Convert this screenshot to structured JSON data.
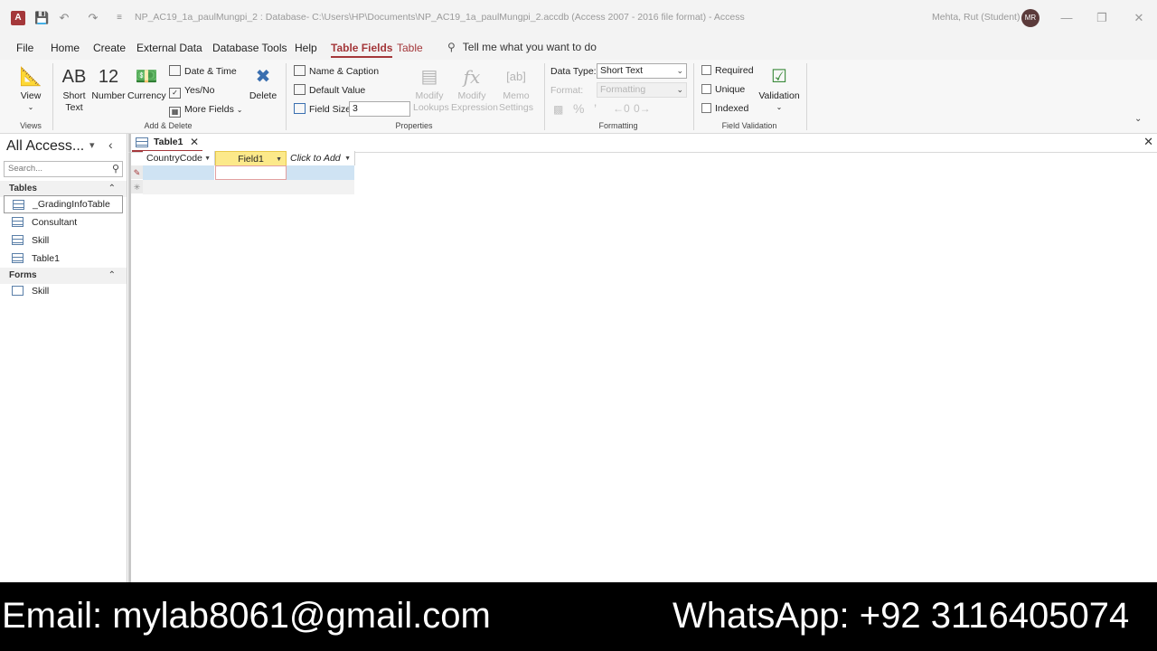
{
  "titlebar": {
    "logo": "A",
    "title": "NP_AC19_1a_paulMungpi_2 : Database- C:\\Users\\HP\\Documents\\NP_AC19_1a_paulMungpi_2.accdb (Access 2007 - 2016 file format) - Access",
    "user": "Mehta, Rut (Student)",
    "avatar_initials": "MR"
  },
  "ribbon_tabs": [
    "File",
    "Home",
    "Create",
    "External Data",
    "Database Tools",
    "Help",
    "Table Fields",
    "Table"
  ],
  "active_tab": "Table Fields",
  "tell_me": "Tell me what you want to do",
  "ribbon": {
    "views": {
      "view_label": "View",
      "group": "Views"
    },
    "add_delete": {
      "short_text_icon": "AB",
      "short_text": "Short Text",
      "number_icon": "12",
      "number": "Number",
      "currency": "Currency",
      "date_time": "Date & Time",
      "yes_no": "Yes/No",
      "more_fields": "More Fields",
      "delete": "Delete",
      "group": "Add & Delete"
    },
    "properties": {
      "name_caption": "Name & Caption",
      "default_value": "Default Value",
      "field_size_label": "Field Size",
      "field_size_value": "3",
      "modify_lookups": "Modify Lookups",
      "modify_expression": "Modify Expression",
      "memo_settings": "Memo Settings",
      "group": "Properties"
    },
    "formatting": {
      "data_type_label": "Data Type:",
      "data_type_value": "Short Text",
      "format_label": "Format:",
      "format_value": "Formatting",
      "group": "Formatting"
    },
    "field_validation": {
      "required": "Required",
      "unique": "Unique",
      "indexed": "Indexed",
      "validation": "Validation",
      "group": "Field Validation"
    }
  },
  "nav": {
    "title": "All Access...",
    "search_placeholder": "Search...",
    "sections": [
      {
        "name": "Tables",
        "items": [
          "_GradingInfoTable",
          "Consultant",
          "Skill",
          "Table1"
        ]
      },
      {
        "name": "Forms",
        "items": [
          "Skill"
        ]
      }
    ]
  },
  "document": {
    "tab_name": "Table1",
    "columns": [
      "CountryCode",
      "Field1",
      "Click to Add"
    ]
  },
  "banner": {
    "email": "Email: mylab8061@gmail.com",
    "whatsapp": "WhatsApp:  +92 3116405074"
  },
  "colors": {
    "accent": "#a4373a",
    "header_selected": "#fce98a",
    "row_current": "#cfe3f3"
  }
}
